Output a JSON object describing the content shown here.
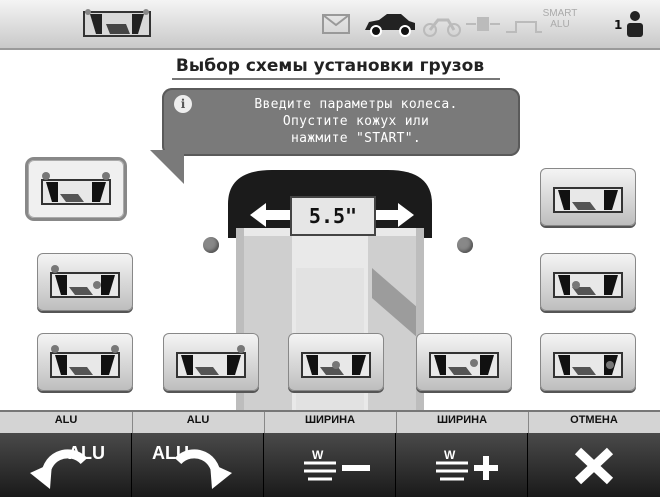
{
  "header": {
    "icons": [
      "wheel-balancer-icon",
      "mail-icon",
      "car-icon",
      "motorcycle-icon",
      "weight-icon",
      "alu-weight-icon"
    ],
    "smart_label": "SMART",
    "smart_sub": "ALU",
    "operator_number": "1"
  },
  "title": "Выбор схемы установки грузов",
  "message": "Введите параметры колеса.\nОпустите кожух или\nнажмите \"START\".",
  "width_value": "5.5\"",
  "schemes": [
    "alu-scheme-1",
    "alu-scheme-2",
    "alu-scheme-3",
    "alu-scheme-4",
    "alu-scheme-5",
    "alu-scheme-6",
    "alu-scheme-7",
    "alu-scheme-8",
    "alu-scheme-9"
  ],
  "function_labels": [
    "ALU",
    "ALU",
    "ШИРИНА",
    "ШИРИНА",
    "ОТМЕНА"
  ],
  "function_buttons": [
    {
      "name": "alu-prev-button",
      "text": "ALU"
    },
    {
      "name": "alu-next-button",
      "text": "ALU"
    },
    {
      "name": "width-minus-button",
      "text": "W"
    },
    {
      "name": "width-plus-button",
      "text": "W"
    },
    {
      "name": "cancel-button",
      "text": ""
    }
  ],
  "colors": {
    "accent": "#7a7a7a",
    "button_bg": "#1e1e1e",
    "icon_white": "#ffffff"
  }
}
